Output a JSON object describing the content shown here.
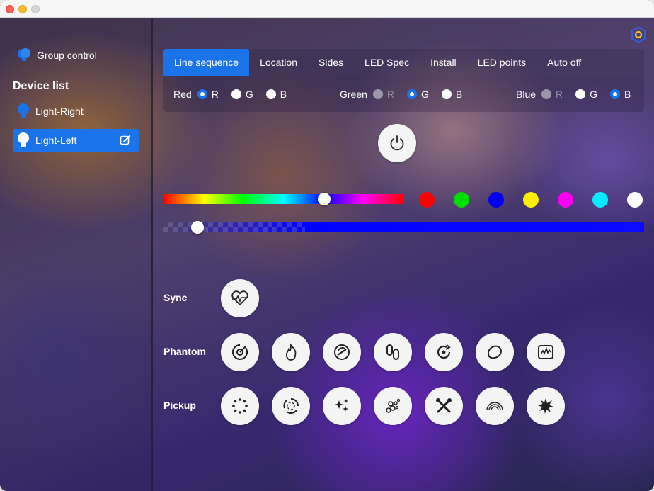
{
  "sidebar": {
    "group_control": "Group control",
    "device_list_title": "Device list",
    "devices": [
      {
        "label": "Light-Right",
        "selected": false
      },
      {
        "label": "Light-Left",
        "selected": true
      }
    ]
  },
  "tabs": [
    {
      "label": "Line sequence",
      "active": true
    },
    {
      "label": "Location",
      "active": false
    },
    {
      "label": "Sides",
      "active": false
    },
    {
      "label": "LED Spec",
      "active": false
    },
    {
      "label": "Install",
      "active": false
    },
    {
      "label": "LED points",
      "active": false
    },
    {
      "label": "Auto off",
      "active": false
    }
  ],
  "rgb_mapping": [
    {
      "name": "Red",
      "options": [
        "R",
        "G",
        "B"
      ],
      "selected": "R",
      "disabled": []
    },
    {
      "name": "Green",
      "options": [
        "R",
        "G",
        "B"
      ],
      "selected": "G",
      "disabled": [
        "R"
      ]
    },
    {
      "name": "Blue",
      "options": [
        "R",
        "G",
        "B"
      ],
      "selected": "B",
      "disabled": [
        "R"
      ]
    }
  ],
  "color": {
    "hue_position": 0.67,
    "brightness_position": 0.07,
    "presets": [
      "#ff0000",
      "#00dd00",
      "#0000ee",
      "#ffee00",
      "#ff00ee",
      "#00eeff",
      "#ffffff"
    ]
  },
  "effects": {
    "sync_label": "Sync",
    "sync_icons": [
      "heartbeat-icon"
    ],
    "phantom_label": "Phantom",
    "phantom_icons": [
      "target-spin-icon",
      "flame-icon",
      "no-entry-swirl-icon",
      "link-icon",
      "rotate-dot-icon",
      "lemon-icon",
      "waveform-icon"
    ],
    "pickup_label": "Pickup",
    "pickup_icons": [
      "dots-circle-icon",
      "spinner-ring-icon",
      "sparkles-icon",
      "bubbles-icon",
      "crossed-tools-icon",
      "rainbow-icon",
      "starburst-icon"
    ]
  },
  "accent_color": "#1a73e8"
}
